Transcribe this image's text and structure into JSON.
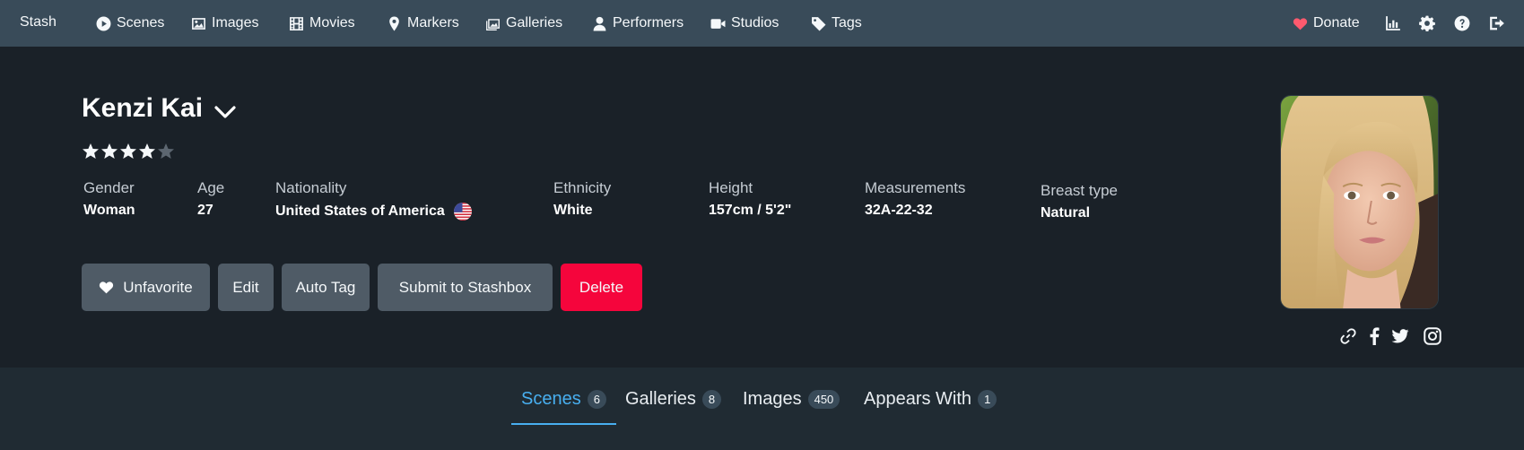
{
  "navbar": {
    "brand": "Stash",
    "items": [
      {
        "label": "Scenes",
        "icon": "play-circle-icon"
      },
      {
        "label": "Images",
        "icon": "image-icon"
      },
      {
        "label": "Movies",
        "icon": "film-icon"
      },
      {
        "label": "Markers",
        "icon": "map-marker-icon"
      },
      {
        "label": "Galleries",
        "icon": "images-icon"
      },
      {
        "label": "Performers",
        "icon": "user-icon"
      },
      {
        "label": "Studios",
        "icon": "video-icon"
      },
      {
        "label": "Tags",
        "icon": "tag-icon"
      }
    ],
    "donate_label": "Donate",
    "right_icons": [
      "chart-icon",
      "gear-icon",
      "help-icon",
      "logout-icon"
    ]
  },
  "performer": {
    "name": "Kenzi Kai",
    "rating": 4,
    "rating_max": 5,
    "details": [
      {
        "label": "Gender",
        "value": "Woman"
      },
      {
        "label": "Age",
        "value": "27"
      },
      {
        "label": "Nationality",
        "value": "United States of America",
        "icon": "us-flag-icon"
      },
      {
        "label": "Ethnicity",
        "value": "White"
      },
      {
        "label": "Height",
        "value": "157cm / 5'2\""
      },
      {
        "label": "Measurements",
        "value": "32A-22-32"
      },
      {
        "label": "Breast type",
        "value": "Natural"
      }
    ],
    "links": [
      "link-icon",
      "facebook-icon",
      "twitter-icon",
      "instagram-icon"
    ]
  },
  "actions": {
    "unfavorite": "Unfavorite",
    "edit": "Edit",
    "auto_tag": "Auto Tag",
    "submit": "Submit to Stashbox",
    "delete": "Delete"
  },
  "tabs": [
    {
      "label": "Scenes",
      "count": "6",
      "active": true
    },
    {
      "label": "Galleries",
      "count": "8"
    },
    {
      "label": "Images",
      "count": "450"
    },
    {
      "label": "Appears With",
      "count": "1"
    }
  ],
  "colors": {
    "navbar": "#394b59",
    "header": "#1a2128",
    "tabs_bar": "#202b33",
    "accent": "#48aff0",
    "danger": "#f5053c",
    "button": "#4f5b66",
    "donate_heart": "#ff5a6e"
  }
}
